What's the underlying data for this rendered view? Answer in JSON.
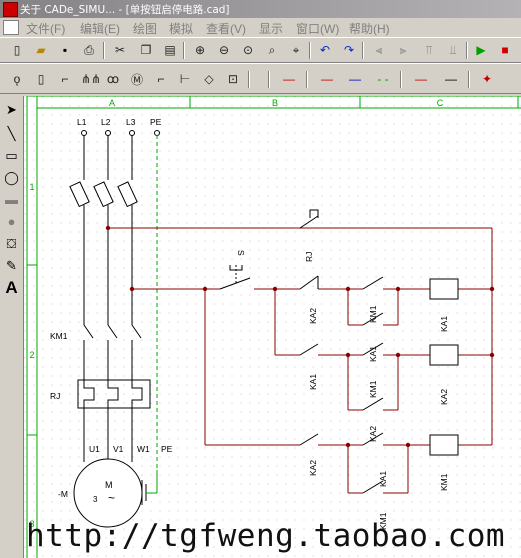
{
  "titlebar": {
    "text": "关于 CADe_SIMU... - [单按钮启停电路.cad]"
  },
  "menu": [
    {
      "id": "file",
      "label": "文件(F)"
    },
    {
      "id": "edit",
      "label": "编辑(E)"
    },
    {
      "id": "draw",
      "label": "绘图"
    },
    {
      "id": "simulate",
      "label": "模拟"
    },
    {
      "id": "view",
      "label": "查看(V)"
    },
    {
      "id": "display",
      "label": "显示"
    },
    {
      "id": "window",
      "label": "窗口(W)"
    },
    {
      "id": "help",
      "label": "帮助(H)"
    }
  ],
  "toolbar_icons": [
    "new-file-icon",
    "open-folder-icon",
    "save-icon",
    "print-icon",
    "cut-icon",
    "copy-icon",
    "paste-icon",
    "zoom-in-icon",
    "zoom-out-icon",
    "zoom-fit-icon",
    "zoom-window-icon",
    "zoom-area-icon",
    "undo-icon",
    "redo-icon",
    "align-left-icon",
    "align-right-icon",
    "align-top-icon",
    "align-bottom-icon",
    "run-simulation-icon",
    "stop-simulation-icon"
  ],
  "tool_colors": {
    "run": "#00a000",
    "stop": "#d00000",
    "wire_red": "#c00000",
    "wire_blue": "#0000c0",
    "wire_green": "#00a000",
    "diagram_wire": "#8b0000",
    "pe_wire": "#00aa00",
    "border": "#00aa00"
  },
  "grid": {
    "columns": [
      "A",
      "B",
      "C"
    ],
    "rows": [
      "1",
      "2",
      "3"
    ]
  },
  "labels": {
    "l1": "L1",
    "l2": "L2",
    "l3": "L3",
    "pe": "PE",
    "km1_main": "KM1",
    "rj_main": "RJ",
    "u1": "U1",
    "v1": "V1",
    "w1": "W1",
    "pe_motor": "PE",
    "motor_m": "M",
    "motor_minus_m": "-M",
    "motor_phase": "3",
    "rj_contact": "RJ",
    "s_button": "S",
    "ka2_r1": "KA2",
    "km1_r1": "KM1",
    "ka1_coil_r1": "KA1",
    "ka1_r2": "KA1",
    "ka1_r2b": "KA1",
    "km1_r2": "KM1",
    "ka2_coil_r2": "KA2",
    "ka1_r3": "KA1",
    "ka2_r3": "KA2",
    "ka2_r3b": "KA2",
    "km1_r3": "KM1",
    "km1_coil_r3": "KM1"
  },
  "watermark": "http://tgfweng.taobao.com"
}
